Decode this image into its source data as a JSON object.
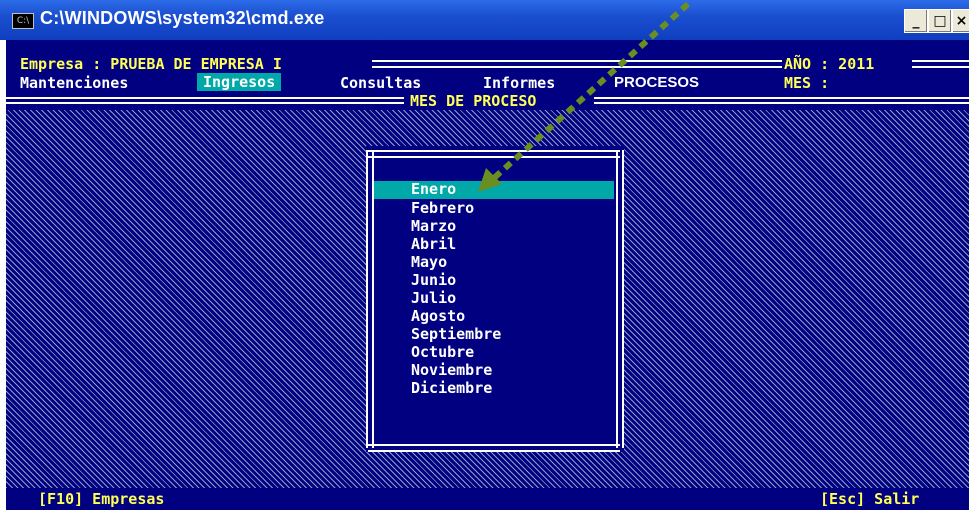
{
  "window": {
    "title": "C:\\WINDOWS\\system32\\cmd.exe",
    "icon_text": "C:\\"
  },
  "header": {
    "empresa": "Empresa : PRUEBA DE EMPRESA I",
    "anio": "AÑO : 2011",
    "mes": "MES :"
  },
  "menu": {
    "items": [
      "Mantenciones",
      "Ingresos",
      "Consultas",
      "Informes",
      "PROCESOS"
    ],
    "selected": "Ingresos"
  },
  "dialog": {
    "title": "MES DE PROCESO",
    "months": [
      "Enero",
      "Febrero",
      "Marzo",
      "Abril",
      "Mayo",
      "Junio",
      "Julio",
      "Agosto",
      "Septiembre",
      "Octubre",
      "Noviembre",
      "Diciembre"
    ],
    "selected": "Enero"
  },
  "status": {
    "left": "[F10] Empresas",
    "right": "[Esc] Salir"
  },
  "colors": {
    "console_bg": "#000080",
    "highlight": "#00a8a8",
    "text_yellow": "#ffff55",
    "arrow": "#6b8e23"
  }
}
